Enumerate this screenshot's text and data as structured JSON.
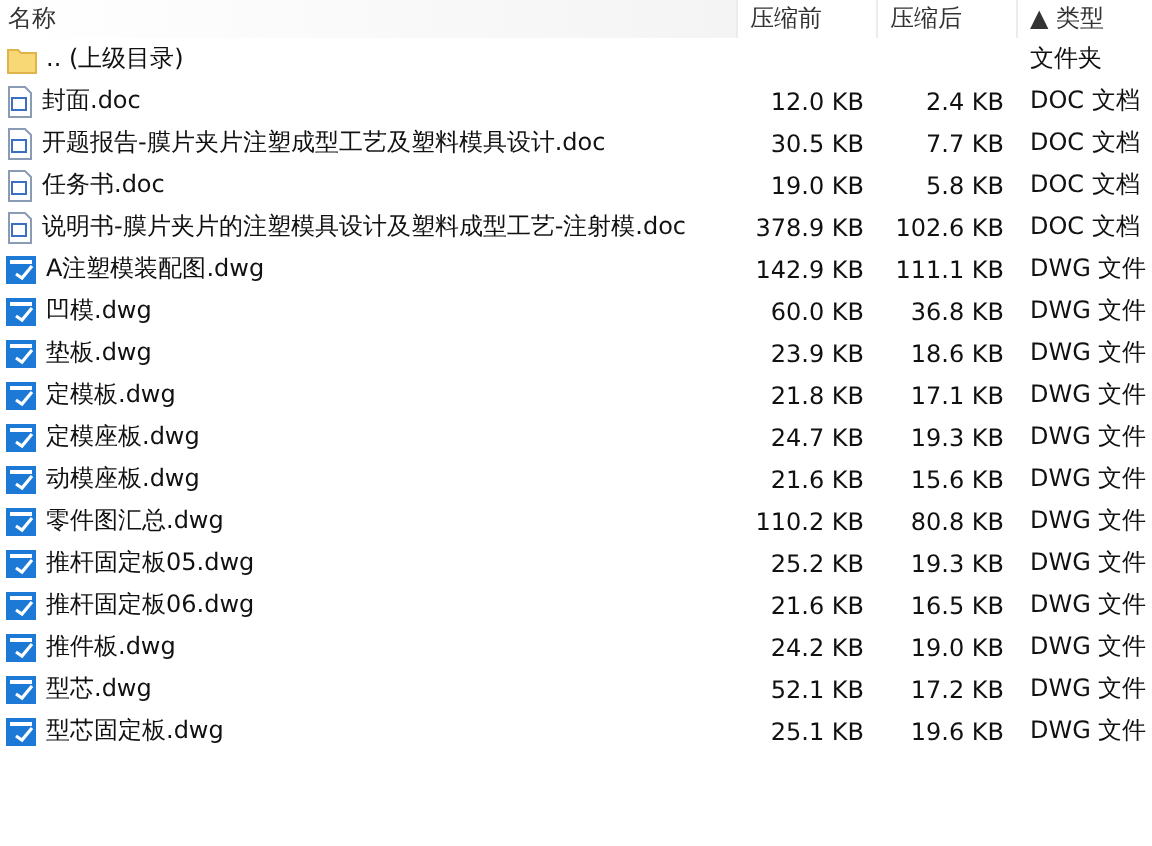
{
  "columns": [
    "名称",
    "压缩前",
    "压缩后",
    "▲ 类型"
  ],
  "rows": [
    {
      "kind": "folder",
      "name": ".. (上级目录)",
      "before": "",
      "after": "",
      "type": "文件夹"
    },
    {
      "kind": "doc",
      "name": "封面.doc",
      "before": "12.0 KB",
      "after": "2.4 KB",
      "type": "DOC 文档"
    },
    {
      "kind": "doc",
      "name": "开题报告-膜片夹片注塑成型工艺及塑料模具设计.doc",
      "before": "30.5 KB",
      "after": "7.7 KB",
      "type": "DOC 文档"
    },
    {
      "kind": "doc",
      "name": "任务书.doc",
      "before": "19.0 KB",
      "after": "5.8 KB",
      "type": "DOC 文档"
    },
    {
      "kind": "doc",
      "name": "说明书-膜片夹片的注塑模具设计及塑料成型工艺-注射模.doc",
      "before": "378.9 KB",
      "after": "102.6 KB",
      "type": "DOC 文档"
    },
    {
      "kind": "dwg",
      "name": "A注塑模装配图.dwg",
      "before": "142.9 KB",
      "after": "111.1 KB",
      "type": "DWG 文件"
    },
    {
      "kind": "dwg",
      "name": "凹模.dwg",
      "before": "60.0 KB",
      "after": "36.8 KB",
      "type": "DWG 文件"
    },
    {
      "kind": "dwg",
      "name": "垫板.dwg",
      "before": "23.9 KB",
      "after": "18.6 KB",
      "type": "DWG 文件"
    },
    {
      "kind": "dwg",
      "name": "定模板.dwg",
      "before": "21.8 KB",
      "after": "17.1 KB",
      "type": "DWG 文件"
    },
    {
      "kind": "dwg",
      "name": "定模座板.dwg",
      "before": "24.7 KB",
      "after": "19.3 KB",
      "type": "DWG 文件"
    },
    {
      "kind": "dwg",
      "name": "动模座板.dwg",
      "before": "21.6 KB",
      "after": "15.6 KB",
      "type": "DWG 文件"
    },
    {
      "kind": "dwg",
      "name": "零件图汇总.dwg",
      "before": "110.2 KB",
      "after": "80.8 KB",
      "type": "DWG 文件"
    },
    {
      "kind": "dwg",
      "name": "推杆固定板05.dwg",
      "before": "25.2 KB",
      "after": "19.3 KB",
      "type": "DWG 文件"
    },
    {
      "kind": "dwg",
      "name": "推杆固定板06.dwg",
      "before": "21.6 KB",
      "after": "16.5 KB",
      "type": "DWG 文件"
    },
    {
      "kind": "dwg",
      "name": "推件板.dwg",
      "before": "24.2 KB",
      "after": "19.0 KB",
      "type": "DWG 文件"
    },
    {
      "kind": "dwg",
      "name": "型芯.dwg",
      "before": "52.1 KB",
      "after": "17.2 KB",
      "type": "DWG 文件"
    },
    {
      "kind": "dwg",
      "name": "型芯固定板.dwg",
      "before": "25.1 KB",
      "after": "19.6 KB",
      "type": "DWG 文件"
    }
  ]
}
